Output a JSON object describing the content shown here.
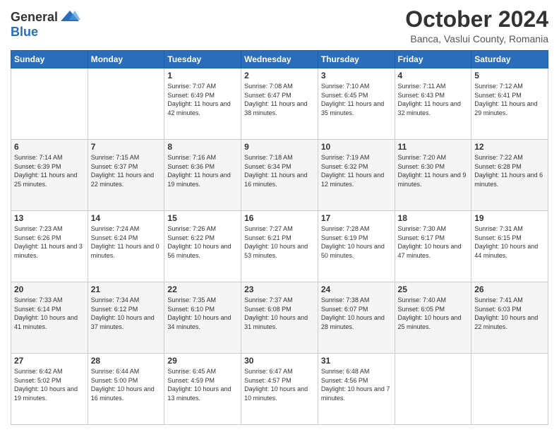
{
  "header": {
    "logo_general": "General",
    "logo_blue": "Blue",
    "month_title": "October 2024",
    "location": "Banca, Vaslui County, Romania"
  },
  "weekdays": [
    "Sunday",
    "Monday",
    "Tuesday",
    "Wednesday",
    "Thursday",
    "Friday",
    "Saturday"
  ],
  "weeks": [
    [
      {
        "day": "",
        "sunrise": "",
        "sunset": "",
        "daylight": ""
      },
      {
        "day": "",
        "sunrise": "",
        "sunset": "",
        "daylight": ""
      },
      {
        "day": "1",
        "sunrise": "Sunrise: 7:07 AM",
        "sunset": "Sunset: 6:49 PM",
        "daylight": "Daylight: 11 hours and 42 minutes."
      },
      {
        "day": "2",
        "sunrise": "Sunrise: 7:08 AM",
        "sunset": "Sunset: 6:47 PM",
        "daylight": "Daylight: 11 hours and 38 minutes."
      },
      {
        "day": "3",
        "sunrise": "Sunrise: 7:10 AM",
        "sunset": "Sunset: 6:45 PM",
        "daylight": "Daylight: 11 hours and 35 minutes."
      },
      {
        "day": "4",
        "sunrise": "Sunrise: 7:11 AM",
        "sunset": "Sunset: 6:43 PM",
        "daylight": "Daylight: 11 hours and 32 minutes."
      },
      {
        "day": "5",
        "sunrise": "Sunrise: 7:12 AM",
        "sunset": "Sunset: 6:41 PM",
        "daylight": "Daylight: 11 hours and 29 minutes."
      }
    ],
    [
      {
        "day": "6",
        "sunrise": "Sunrise: 7:14 AM",
        "sunset": "Sunset: 6:39 PM",
        "daylight": "Daylight: 11 hours and 25 minutes."
      },
      {
        "day": "7",
        "sunrise": "Sunrise: 7:15 AM",
        "sunset": "Sunset: 6:37 PM",
        "daylight": "Daylight: 11 hours and 22 minutes."
      },
      {
        "day": "8",
        "sunrise": "Sunrise: 7:16 AM",
        "sunset": "Sunset: 6:36 PM",
        "daylight": "Daylight: 11 hours and 19 minutes."
      },
      {
        "day": "9",
        "sunrise": "Sunrise: 7:18 AM",
        "sunset": "Sunset: 6:34 PM",
        "daylight": "Daylight: 11 hours and 16 minutes."
      },
      {
        "day": "10",
        "sunrise": "Sunrise: 7:19 AM",
        "sunset": "Sunset: 6:32 PM",
        "daylight": "Daylight: 11 hours and 12 minutes."
      },
      {
        "day": "11",
        "sunrise": "Sunrise: 7:20 AM",
        "sunset": "Sunset: 6:30 PM",
        "daylight": "Daylight: 11 hours and 9 minutes."
      },
      {
        "day": "12",
        "sunrise": "Sunrise: 7:22 AM",
        "sunset": "Sunset: 6:28 PM",
        "daylight": "Daylight: 11 hours and 6 minutes."
      }
    ],
    [
      {
        "day": "13",
        "sunrise": "Sunrise: 7:23 AM",
        "sunset": "Sunset: 6:26 PM",
        "daylight": "Daylight: 11 hours and 3 minutes."
      },
      {
        "day": "14",
        "sunrise": "Sunrise: 7:24 AM",
        "sunset": "Sunset: 6:24 PM",
        "daylight": "Daylight: 11 hours and 0 minutes."
      },
      {
        "day": "15",
        "sunrise": "Sunrise: 7:26 AM",
        "sunset": "Sunset: 6:22 PM",
        "daylight": "Daylight: 10 hours and 56 minutes."
      },
      {
        "day": "16",
        "sunrise": "Sunrise: 7:27 AM",
        "sunset": "Sunset: 6:21 PM",
        "daylight": "Daylight: 10 hours and 53 minutes."
      },
      {
        "day": "17",
        "sunrise": "Sunrise: 7:28 AM",
        "sunset": "Sunset: 6:19 PM",
        "daylight": "Daylight: 10 hours and 50 minutes."
      },
      {
        "day": "18",
        "sunrise": "Sunrise: 7:30 AM",
        "sunset": "Sunset: 6:17 PM",
        "daylight": "Daylight: 10 hours and 47 minutes."
      },
      {
        "day": "19",
        "sunrise": "Sunrise: 7:31 AM",
        "sunset": "Sunset: 6:15 PM",
        "daylight": "Daylight: 10 hours and 44 minutes."
      }
    ],
    [
      {
        "day": "20",
        "sunrise": "Sunrise: 7:33 AM",
        "sunset": "Sunset: 6:14 PM",
        "daylight": "Daylight: 10 hours and 41 minutes."
      },
      {
        "day": "21",
        "sunrise": "Sunrise: 7:34 AM",
        "sunset": "Sunset: 6:12 PM",
        "daylight": "Daylight: 10 hours and 37 minutes."
      },
      {
        "day": "22",
        "sunrise": "Sunrise: 7:35 AM",
        "sunset": "Sunset: 6:10 PM",
        "daylight": "Daylight: 10 hours and 34 minutes."
      },
      {
        "day": "23",
        "sunrise": "Sunrise: 7:37 AM",
        "sunset": "Sunset: 6:08 PM",
        "daylight": "Daylight: 10 hours and 31 minutes."
      },
      {
        "day": "24",
        "sunrise": "Sunrise: 7:38 AM",
        "sunset": "Sunset: 6:07 PM",
        "daylight": "Daylight: 10 hours and 28 minutes."
      },
      {
        "day": "25",
        "sunrise": "Sunrise: 7:40 AM",
        "sunset": "Sunset: 6:05 PM",
        "daylight": "Daylight: 10 hours and 25 minutes."
      },
      {
        "day": "26",
        "sunrise": "Sunrise: 7:41 AM",
        "sunset": "Sunset: 6:03 PM",
        "daylight": "Daylight: 10 hours and 22 minutes."
      }
    ],
    [
      {
        "day": "27",
        "sunrise": "Sunrise: 6:42 AM",
        "sunset": "Sunset: 5:02 PM",
        "daylight": "Daylight: 10 hours and 19 minutes."
      },
      {
        "day": "28",
        "sunrise": "Sunrise: 6:44 AM",
        "sunset": "Sunset: 5:00 PM",
        "daylight": "Daylight: 10 hours and 16 minutes."
      },
      {
        "day": "29",
        "sunrise": "Sunrise: 6:45 AM",
        "sunset": "Sunset: 4:59 PM",
        "daylight": "Daylight: 10 hours and 13 minutes."
      },
      {
        "day": "30",
        "sunrise": "Sunrise: 6:47 AM",
        "sunset": "Sunset: 4:57 PM",
        "daylight": "Daylight: 10 hours and 10 minutes."
      },
      {
        "day": "31",
        "sunrise": "Sunrise: 6:48 AM",
        "sunset": "Sunset: 4:56 PM",
        "daylight": "Daylight: 10 hours and 7 minutes."
      },
      {
        "day": "",
        "sunrise": "",
        "sunset": "",
        "daylight": ""
      },
      {
        "day": "",
        "sunrise": "",
        "sunset": "",
        "daylight": ""
      }
    ]
  ]
}
